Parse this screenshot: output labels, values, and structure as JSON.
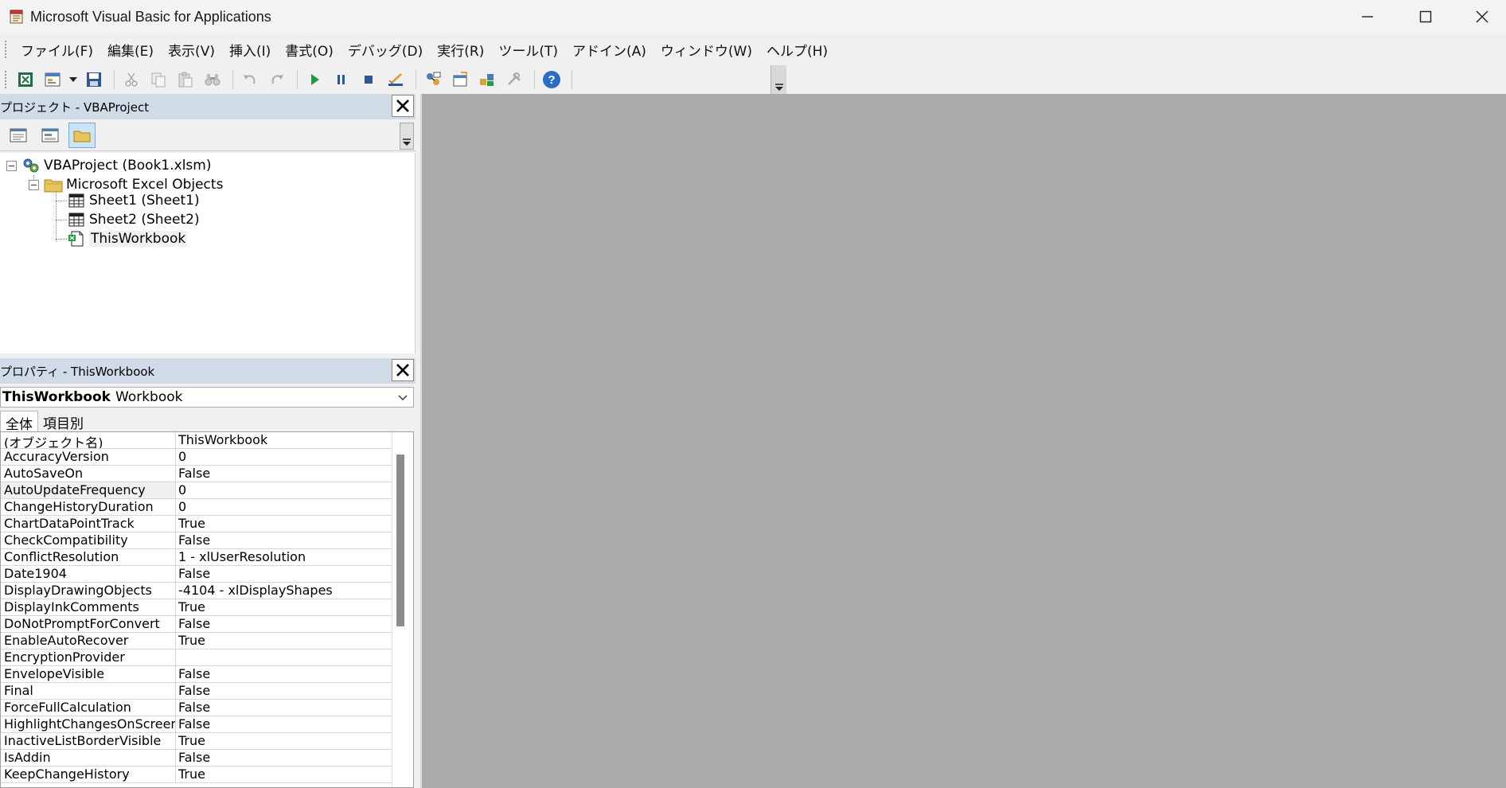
{
  "window": {
    "title": "Microsoft Visual Basic for Applications"
  },
  "menu": {
    "items": [
      "ファイル(F)",
      "編集(E)",
      "表示(V)",
      "挿入(I)",
      "書式(O)",
      "デバッグ(D)",
      "実行(R)",
      "ツール(T)",
      "アドイン(A)",
      "ウィンドウ(W)",
      "ヘルプ(H)"
    ]
  },
  "project": {
    "header": "プロジェクト - VBAProject",
    "root": "VBAProject (Book1.xlsm)",
    "folder": "Microsoft Excel Objects",
    "items": [
      "Sheet1 (Sheet1)",
      "Sheet2 (Sheet2)",
      "ThisWorkbook"
    ]
  },
  "properties": {
    "header": "プロパティ - ThisWorkbook",
    "object_name": "ThisWorkbook",
    "object_type": "Workbook",
    "tabs": [
      "全体",
      "項目別"
    ],
    "rows": [
      {
        "name": "(オブジェクト名)",
        "value": "ThisWorkbook"
      },
      {
        "name": "AccuracyVersion",
        "value": "0"
      },
      {
        "name": "AutoSaveOn",
        "value": "False"
      },
      {
        "name": "AutoUpdateFrequency",
        "value": "0"
      },
      {
        "name": "ChangeHistoryDuration",
        "value": "0"
      },
      {
        "name": "ChartDataPointTrack",
        "value": "True"
      },
      {
        "name": "CheckCompatibility",
        "value": "False"
      },
      {
        "name": "ConflictResolution",
        "value": "1 - xlUserResolution"
      },
      {
        "name": "Date1904",
        "value": "False"
      },
      {
        "name": "DisplayDrawingObjects",
        "value": "-4104 - xlDisplayShapes"
      },
      {
        "name": "DisplayInkComments",
        "value": "True"
      },
      {
        "name": "DoNotPromptForConvert",
        "value": "False"
      },
      {
        "name": "EnableAutoRecover",
        "value": "True"
      },
      {
        "name": "EncryptionProvider",
        "value": ""
      },
      {
        "name": "EnvelopeVisible",
        "value": "False"
      },
      {
        "name": "Final",
        "value": "False"
      },
      {
        "name": "ForceFullCalculation",
        "value": "False"
      },
      {
        "name": "HighlightChangesOnScreen",
        "value": "False"
      },
      {
        "name": "InactiveListBorderVisible",
        "value": "True"
      },
      {
        "name": "IsAddin",
        "value": "False"
      },
      {
        "name": "KeepChangeHistory",
        "value": "True"
      }
    ]
  }
}
